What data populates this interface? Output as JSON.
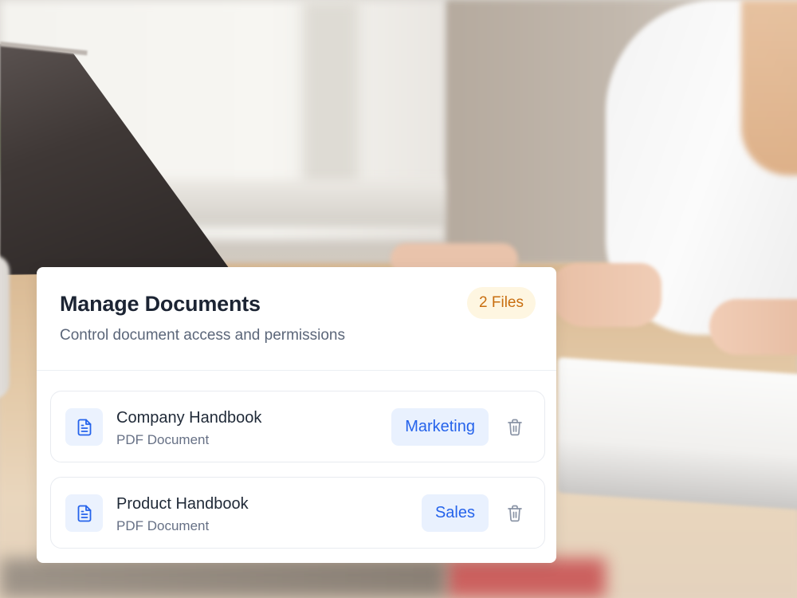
{
  "card": {
    "title": "Manage Documents",
    "subtitle": "Control document access and permissions",
    "file_count_badge": "2 Files"
  },
  "documents": [
    {
      "name": "Company Handbook",
      "type": "PDF Document",
      "tag": "Marketing",
      "icon": "document-icon",
      "action_icon": "trash-icon"
    },
    {
      "name": "Product Handbook",
      "type": "PDF Document",
      "tag": "Sales",
      "icon": "document-icon",
      "action_icon": "trash-icon"
    }
  ],
  "colors": {
    "badge_background": "#fef6e1",
    "badge_text": "#c86e0f",
    "tag_background": "#e9f1fe",
    "tag_text": "#2563eb",
    "icon_tile": "#ebf2fe",
    "title_text": "#1c2433",
    "muted_text": "#5b6679"
  }
}
